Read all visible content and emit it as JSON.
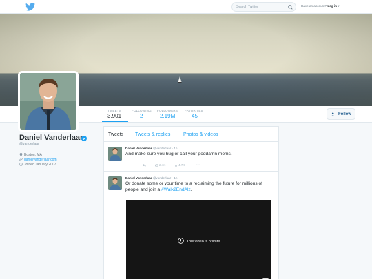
{
  "topnav": {
    "search_placeholder": "Search Twitter",
    "account_prompt": "Have an account?",
    "login_label": "Log in"
  },
  "profile": {
    "name": "Daniel Vanderlaar",
    "handle": "@vanderlaar",
    "location": "Boston, MA",
    "website": "danielvanderlaar.com",
    "joined": "Joined January 2007"
  },
  "stats": [
    {
      "label": "TWEETS",
      "value": "3,901"
    },
    {
      "label": "FOLLOWING",
      "value": "2"
    },
    {
      "label": "FOLLOWERS",
      "value": "2.19M"
    },
    {
      "label": "FAVORITES",
      "value": "45"
    }
  ],
  "follow_label": "Follow",
  "tabs": [
    "Tweets",
    "Tweets & replies",
    "Photos & videos"
  ],
  "tweets": [
    {
      "author": "Daniel Vanderlaar",
      "handle": "@vanderlaar",
      "time": "1h",
      "text": "And make sure you hug or call your goddamn moms.",
      "retweets": "2.1K",
      "likes": "4.7K"
    },
    {
      "author": "Daniel Vanderlaar",
      "handle": "@vanderlaar",
      "time": "1h",
      "text_before": "Or donate some or your time to a reclaiming the future for millions of people and join a ",
      "hashtag": "#Walk2EndAlz",
      "text_after": ".",
      "video_message": "This video is private"
    }
  ],
  "colors": {
    "accent": "#1da1f2",
    "follow_text": "#1d5a8c",
    "background": "#f5f8fa"
  }
}
